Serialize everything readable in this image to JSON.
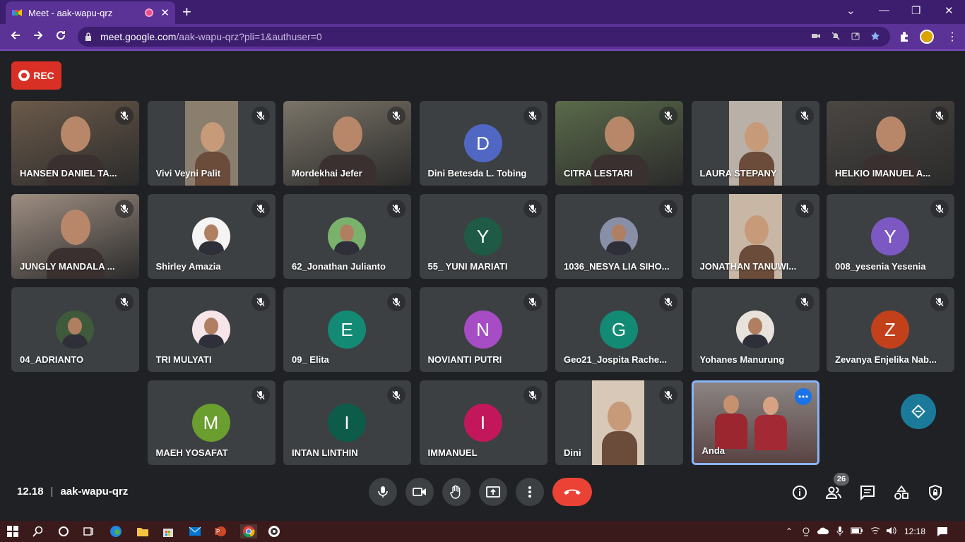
{
  "browser": {
    "tab_title": "Meet - aak-wapu-qrz",
    "tab_close": "✕",
    "new_tab": "+",
    "url_host": "meet.google.com",
    "url_path": "/aak-wapu-qrz?pli=1&authuser=0",
    "window_controls": [
      "⌄",
      "—",
      "❐",
      "✕"
    ]
  },
  "recording": {
    "label": "REC"
  },
  "participants": [
    {
      "name": "HANSEN DANIEL TA...",
      "type": "video"
    },
    {
      "name": "Vivi Veyni Palit",
      "type": "video"
    },
    {
      "name": "Mordekhai Jefer",
      "type": "video"
    },
    {
      "name": "Dini Betesda L. Tobing",
      "type": "initial",
      "initial": "D",
      "color": "#5167c4"
    },
    {
      "name": "CITRA LESTARI",
      "type": "video"
    },
    {
      "name": "LAURA STEPANY",
      "type": "video"
    },
    {
      "name": "HELKIO IMANUEL A...",
      "type": "video"
    },
    {
      "name": "JUNGLY MANDALA ...",
      "type": "video"
    },
    {
      "name": "Shirley Amazia",
      "type": "photo"
    },
    {
      "name": "62_Jonathan Julianto",
      "type": "photo"
    },
    {
      "name": "55_ YUNI MARIATI",
      "type": "initial",
      "initial": "Y",
      "color": "#1e5a46"
    },
    {
      "name": "1036_NESYA LIA SIHO...",
      "type": "photo"
    },
    {
      "name": "JONATHAN TANUWI...",
      "type": "video"
    },
    {
      "name": "008_yesenia Yesenia",
      "type": "initial",
      "initial": "Y",
      "color": "#7c58c2"
    },
    {
      "name": "04_ADRIANTO",
      "type": "photo"
    },
    {
      "name": "TRI MULYATI",
      "type": "photo"
    },
    {
      "name": "09_ Elita",
      "type": "initial",
      "initial": "E",
      "color": "#138a74"
    },
    {
      "name": "NOVIANTI PUTRI",
      "type": "initial",
      "initial": "N",
      "color": "#a64cc4"
    },
    {
      "name": "Geo21_Jospita Rache...",
      "type": "initial",
      "initial": "G",
      "color": "#138a74"
    },
    {
      "name": "Yohanes Manurung",
      "type": "photo"
    },
    {
      "name": "Zevanya Enjelika Nab...",
      "type": "initial",
      "initial": "Z",
      "color": "#c2401a"
    },
    {
      "name": "MAEH YOSAFAT",
      "type": "initial",
      "initial": "M",
      "color": "#6a9e2e"
    },
    {
      "name": "INTAN LINTHIN",
      "type": "initial",
      "initial": "I",
      "color": "#0d5c4a"
    },
    {
      "name": "IMMANUEL",
      "type": "initial",
      "initial": "I",
      "color": "#c2185b"
    },
    {
      "name": "Dini",
      "type": "video"
    },
    {
      "name": "Anda",
      "type": "self"
    }
  ],
  "meeting": {
    "time": "12.18",
    "separator": "|",
    "code": "aak-wapu-qrz"
  },
  "people_count": "26",
  "taskbar": {
    "clock": "12:18"
  },
  "colors": {
    "accent": "#8ab4f8",
    "hangup": "#ea4335",
    "chrome": "#5b3296",
    "rec": "#d93025"
  }
}
